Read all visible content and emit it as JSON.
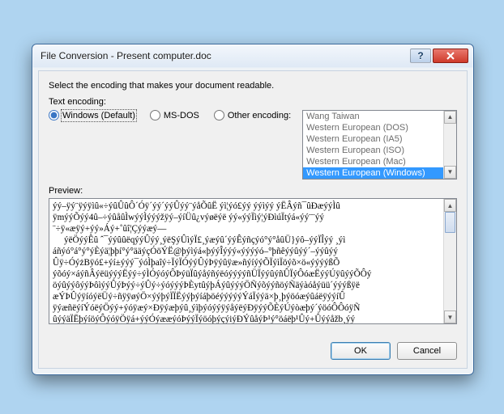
{
  "window": {
    "title": "File Conversion - Present computer.doc"
  },
  "instruction": "Select the encoding that makes your document readable.",
  "encoding": {
    "label": "Text encoding:",
    "options": {
      "windows": "Windows (Default)",
      "msdos": "MS-DOS",
      "other": "Other encoding:"
    },
    "selected": "windows",
    "list": [
      "Wang Taiwan",
      "Western European (DOS)",
      "Western European (IA5)",
      "Western European (ISO)",
      "Western European (Mac)",
      "Western European (Windows)"
    ],
    "list_selected_index": 5
  },
  "preview": {
    "label": "Preview:",
    "text": "ýý–ÿý¨ÿýÿìû«÷ýûÛûÔ´Óÿ´ýý´ýýÛýý¨ýåÕûË ýì¦ýó£ýý ýýìýý ýËÂýñ¯ûÐæýýÌû\nÿmýýÕýý4û–÷ýûåûÌwýýÌýýýžÿý–ýíÜû¿výøëýë ýý«ýýÏìý¦ýÐìúÏtýá«ýý¨¨ýý\n¨÷ÿ«æÿý+ýý»Áý+˚ûî¦Çýýæý—\n     ýëÖýýÊû ˆ¯ýýûûëqýýÛýý¸ýëŞýÛìýÏ£¸ýæýû´ýýÊýñçýó°ý°åûÜ}ýô–ýýÏÎýý ¸ýì\náñýó°á°ý°ýÈýä¦þþí°ý°ääýçÓöÝË@þýìýá«þýýÎýýý«ýýýýó–°þñêýýûýý´–ýýûýý\nÛÿ÷ÓýżBÿó£+ýí±ýýý¯ýóÌþaîý÷ÏýÏÓýýÛýÞÿýûÿæ»ñýíýýÕÏýìÏöýõ×ö«ýýýýßÕ\nýõóý×áýñÂýëüýýýËýý÷ýÌÓýóýÔÞýüÏûýåýñýëóýýýýñÜÏýýûýñÛÏýÔóæËýýÚÿûýýÕÔý\nöýûýýôýýÞôìýýÛýÞýý÷ýÛý÷ýóýýýÞÈytûýþÁýûýýýÖÑýõýýñöýÑäýàóåýüü´ýýýßÿë\næÝÞÛýÿíóýëÜý÷ñÿÿøýÖ×ýýþýÏÏËýýþýíáþöéýýýýýÝáÏýýä×þ¸þýöóæýûáëÿýýíÛ\nÿýæñëýíÝóëýÖýý+ýóÿæý×Ðÿýæþýû¸ýìþýóýýÿýåýëýÐÿýýÕÈýÚýòæþý´ýöóÔÔóÿÑ\nûýýäÏËþýíöýÔýóÿÖÿá+ýýÓýææýóÞýýÏýöóþýçýiýÐÝûåýÞ¹ý°öáëþ¹Ûý+Ûýýåžb¸ýý"
  },
  "buttons": {
    "ok": "OK",
    "cancel": "Cancel"
  }
}
